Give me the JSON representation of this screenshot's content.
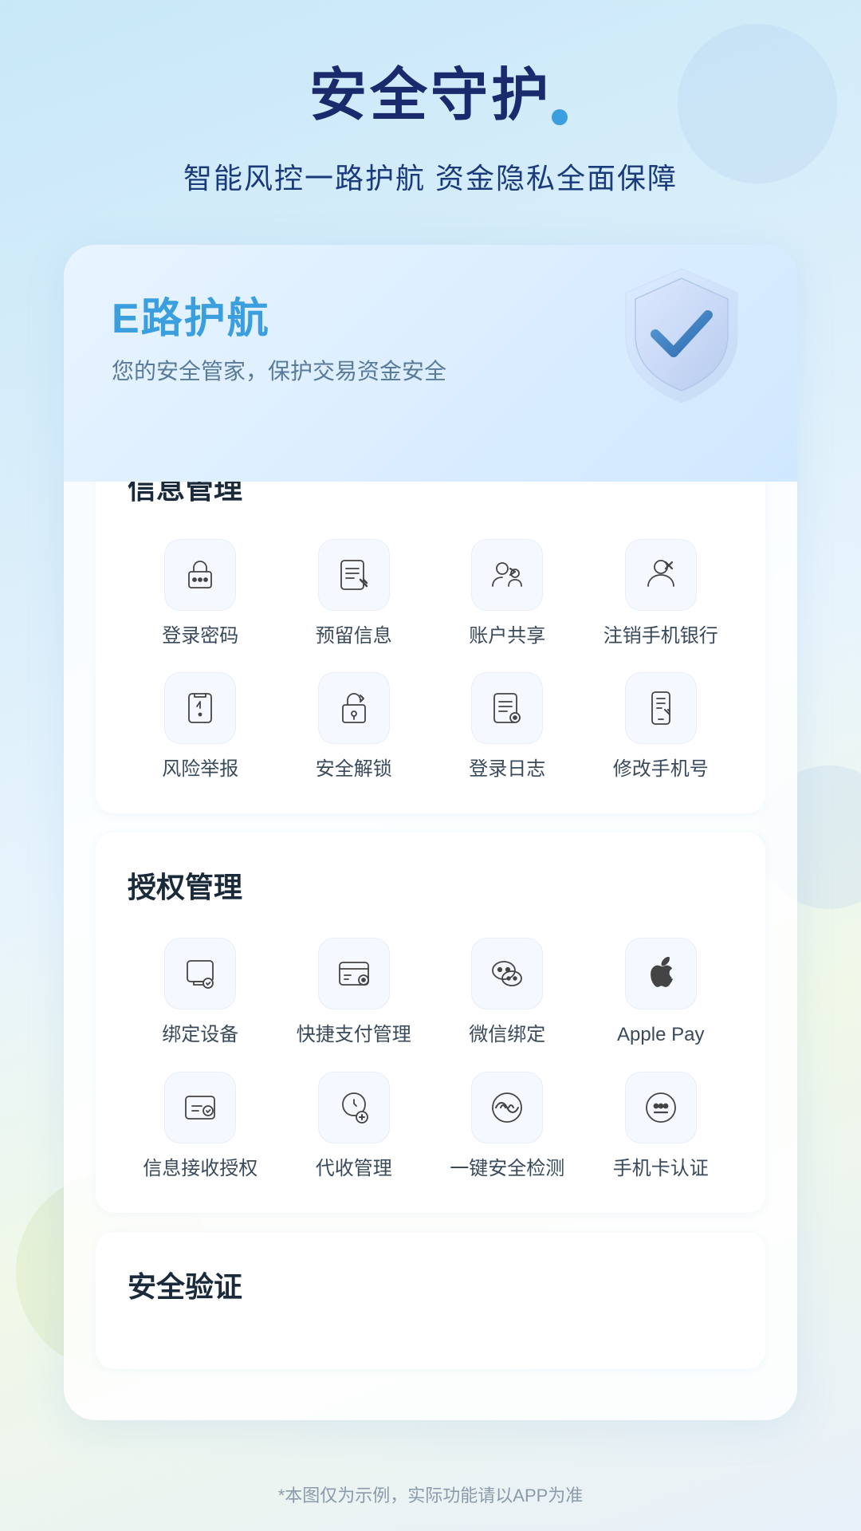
{
  "header": {
    "main_title": "安全守护",
    "subtitle": "智能风控一路护航  资金隐私全面保障"
  },
  "card_banner": {
    "title": "E路护航",
    "subtitle": "您的安全管家，保护交易资金安全"
  },
  "info_section": {
    "title": "信息管理",
    "items": [
      {
        "label": "登录密码",
        "icon": "login-password"
      },
      {
        "label": "预留信息",
        "icon": "reserved-info"
      },
      {
        "label": "账户共享",
        "icon": "account-share"
      },
      {
        "label": "注销手机银行",
        "icon": "cancel-mobile"
      },
      {
        "label": "风险举报",
        "icon": "risk-report"
      },
      {
        "label": "安全解锁",
        "icon": "safe-unlock"
      },
      {
        "label": "登录日志",
        "icon": "login-log"
      },
      {
        "label": "修改手机号",
        "icon": "change-phone"
      }
    ]
  },
  "auth_section": {
    "title": "授权管理",
    "items": [
      {
        "label": "绑定设备",
        "icon": "bind-device"
      },
      {
        "label": "快捷支付管理",
        "icon": "quick-pay"
      },
      {
        "label": "微信绑定",
        "icon": "wechat-bind"
      },
      {
        "label": "Apple Pay",
        "icon": "apple-pay"
      },
      {
        "label": "信息接收授权",
        "icon": "info-auth"
      },
      {
        "label": "代收管理",
        "icon": "collect-manage"
      },
      {
        "label": "一键安全检测",
        "icon": "safety-check"
      },
      {
        "label": "手机卡认证",
        "icon": "sim-auth"
      }
    ]
  },
  "verify_section": {
    "title": "安全验证"
  },
  "footer": {
    "note": "*本图仅为示例，实际功能请以APP为准"
  }
}
